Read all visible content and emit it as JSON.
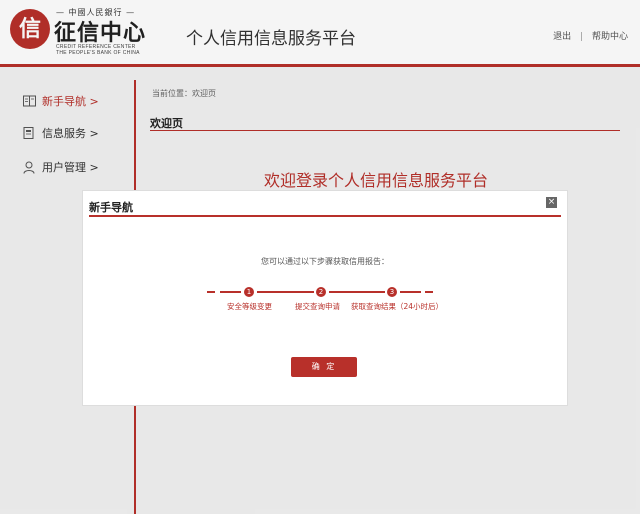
{
  "header": {
    "logo_mark": "信",
    "logo_top": "— 中國人民銀行 —",
    "logo_main": "征信中心",
    "logo_en_line1": "CREDIT REFERENCE CENTER",
    "logo_en_line2": "THE PEOPLE'S BANK OF CHINA",
    "platform_title": "个人信用信息服务平台",
    "logout": "退出",
    "separator": "|",
    "help": "帮助中心"
  },
  "sidebar": {
    "items": [
      {
        "label": "新手导航 >",
        "icon": "book-icon"
      },
      {
        "label": "信息服务 >",
        "icon": "document-icon"
      },
      {
        "label": "用户管理 >",
        "icon": "user-icon"
      }
    ]
  },
  "main": {
    "breadcrumb": "当前位置：欢迎页",
    "heading": "欢迎页",
    "welcome_title": "欢迎登录个人信用信息服务平台"
  },
  "modal": {
    "title": "新手导航",
    "close": "×",
    "description": "您可以通过以下步骤获取信用报告：",
    "steps": [
      {
        "number": "1",
        "label": "安全等级变更"
      },
      {
        "number": "2",
        "label": "提交查询申请"
      },
      {
        "number": "3",
        "label": "获取查询结果（24小时后）"
      }
    ],
    "confirm_label": "确 定"
  },
  "colors": {
    "accent": "#b8302a",
    "background": "#f2f2f2"
  }
}
